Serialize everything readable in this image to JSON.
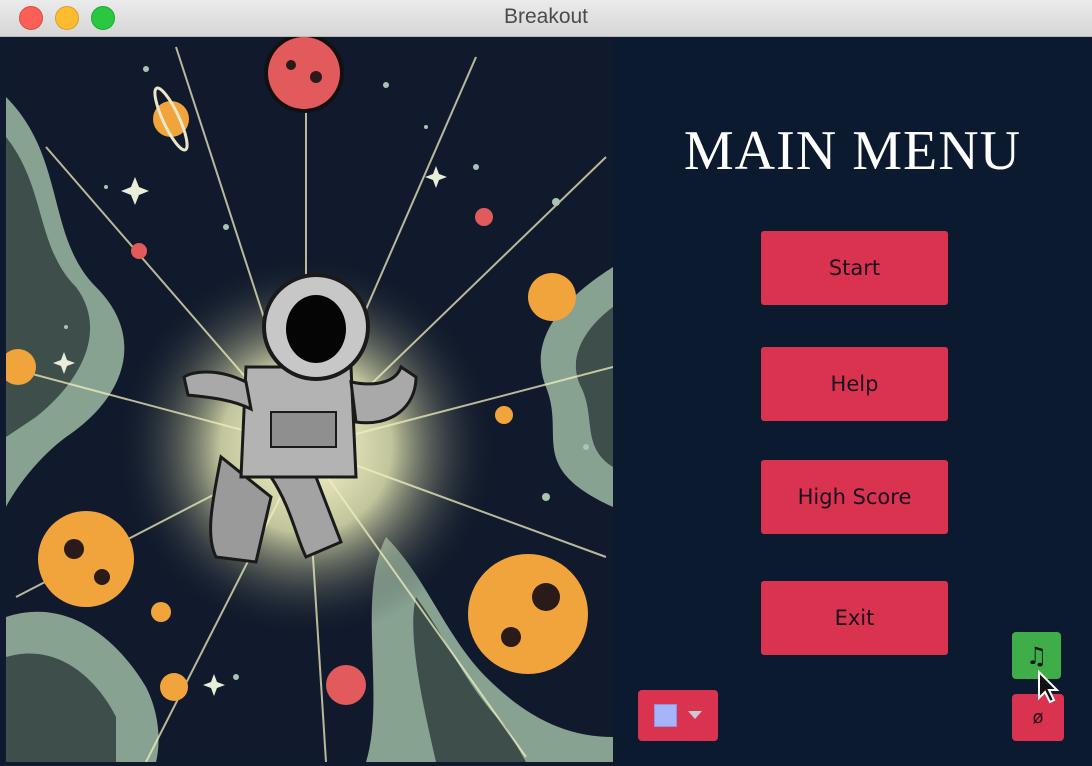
{
  "window": {
    "title": "Breakout"
  },
  "menu": {
    "title": "MAIN MENU",
    "buttons": {
      "start": "Start",
      "help": "Help",
      "high_score": "High Score",
      "exit": "Exit"
    }
  },
  "controls": {
    "music_glyph": "♫",
    "mute_glyph": "ø",
    "color_value": "#a7b4f7"
  },
  "colors": {
    "panel_bg": "#0c1a2f",
    "button_bg": "#d93350",
    "music_button_bg": "#3fae48",
    "title_text": "#ffffff"
  },
  "artwork": {
    "subject": "astronaut-space-illustration"
  }
}
